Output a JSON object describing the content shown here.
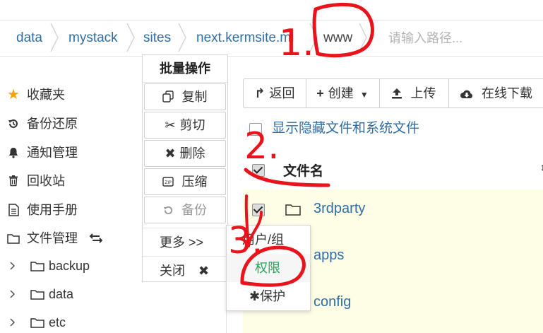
{
  "breadcrumb": {
    "items": [
      "data",
      "mystack",
      "sites",
      "next.kermsite.ml",
      "www"
    ],
    "input_placeholder": "请输入路径..."
  },
  "sidebar": {
    "items": [
      {
        "label": "收藏夹",
        "icon": "star-icon"
      },
      {
        "label": "备份还原",
        "icon": "history-icon"
      },
      {
        "label": "通知管理",
        "icon": "bell-icon"
      },
      {
        "label": "回收站",
        "icon": "trash-icon"
      },
      {
        "label": "使用手册",
        "icon": "document-icon"
      },
      {
        "label": "文件管理",
        "icon": "folder-icon"
      }
    ],
    "tree": [
      "backup",
      "data",
      "etc"
    ]
  },
  "batch_menu": {
    "title": "批量操作",
    "actions": [
      {
        "label": "复制",
        "icon": "copy-icon"
      },
      {
        "label": "剪切",
        "icon": "scissors-icon"
      },
      {
        "label": "删除",
        "icon": "close-icon"
      },
      {
        "label": "压缩",
        "icon": "zip-icon"
      },
      {
        "label": "备份",
        "icon": "history-icon"
      }
    ],
    "more": "更多 >>",
    "close": "关闭"
  },
  "submenu": {
    "items": [
      "用户/组",
      "权限",
      "保护"
    ]
  },
  "toolbar": {
    "back": "返回",
    "create": "创建",
    "upload": "上传",
    "download": "在线下载"
  },
  "show_hidden_label": "显示隐藏文件和系统文件",
  "table": {
    "header": "文件名",
    "rows": [
      "3rdparty",
      "apps",
      "config"
    ]
  },
  "annotations": [
    "1.",
    "2.",
    "3."
  ],
  "colors": {
    "link": "#2f6ea5",
    "annotation": "#e8131b",
    "row_highlight": "#fefde6",
    "submenu_active": "#27a05a"
  }
}
